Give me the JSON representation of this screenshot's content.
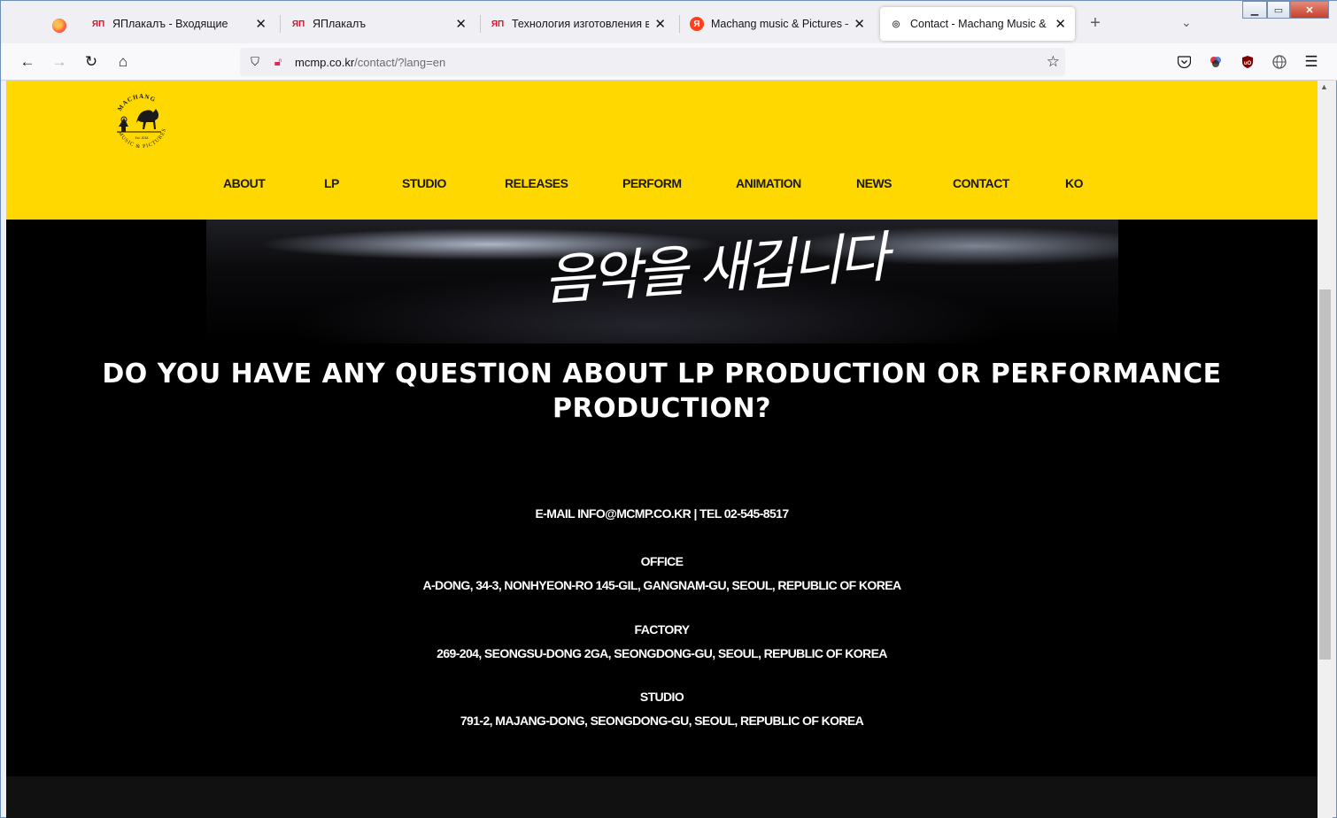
{
  "browser": {
    "tabs": [
      {
        "title": "ЯПлакалъ - Входящие",
        "fav": "ЯП",
        "fav_color": "#e0102a"
      },
      {
        "title": "ЯПлакалъ",
        "fav": "ЯП",
        "fav_color": "#e0102a"
      },
      {
        "title": "Технология изготовления вини",
        "fav": "ЯП",
        "fav_color": "#e0102a"
      },
      {
        "title": "Machang music & Pictures — Я",
        "fav": "Я",
        "fav_color": "#fc3f1d"
      },
      {
        "title": "Contact - Machang Music & Pic",
        "fav": "◎",
        "fav_color": "#444444"
      }
    ],
    "active_tab": 4,
    "url_host": "mcmp.co.kr",
    "url_path": "/contact/?lang=en",
    "window_controls": {
      "minimize": "▁",
      "maximize": "▭",
      "close": "✕"
    }
  },
  "site": {
    "logo_ring_text_top": "MACHANG",
    "logo_ring_text_bottom": "MUSIC & PICTURES",
    "logo_est": "Est. 2018",
    "nav": [
      "ABOUT",
      "LP",
      "STUDIO",
      "RELEASES",
      "PERFORM",
      "ANIMATION",
      "NEWS",
      "CONTACT",
      "KO"
    ],
    "hero_calligraphy": "음악을 새깁니다",
    "headline_line1": "DO YOU HAVE ANY QUESTION ABOUT LP PRODUCTION OR PERFORMANCE",
    "headline_line2": "PRODUCTION?",
    "contact_line": "E-MAIL INFO@MCMP.CO.KR | TEL 02-545-8517",
    "office_label": "OFFICE",
    "office_address": "A-DONG, 34-3, NONHYEON-RO 145-GIL, GANGNAM-GU, SEOUL, REPUBLIC OF KOREA",
    "factory_label": "FACTORY",
    "factory_address": "269-204, SEONGSU-DONG 2GA, SEONGDONG-GU, SEOUL, REPUBLIC OF KOREA",
    "studio_label": "STUDIO",
    "studio_address": "791-2, MAJANG-DONG, SEONGDONG-GU, SEOUL, REPUBLIC OF KOREA"
  },
  "colors": {
    "header_yellow": "#ffd800",
    "page_bg": "#000000"
  }
}
